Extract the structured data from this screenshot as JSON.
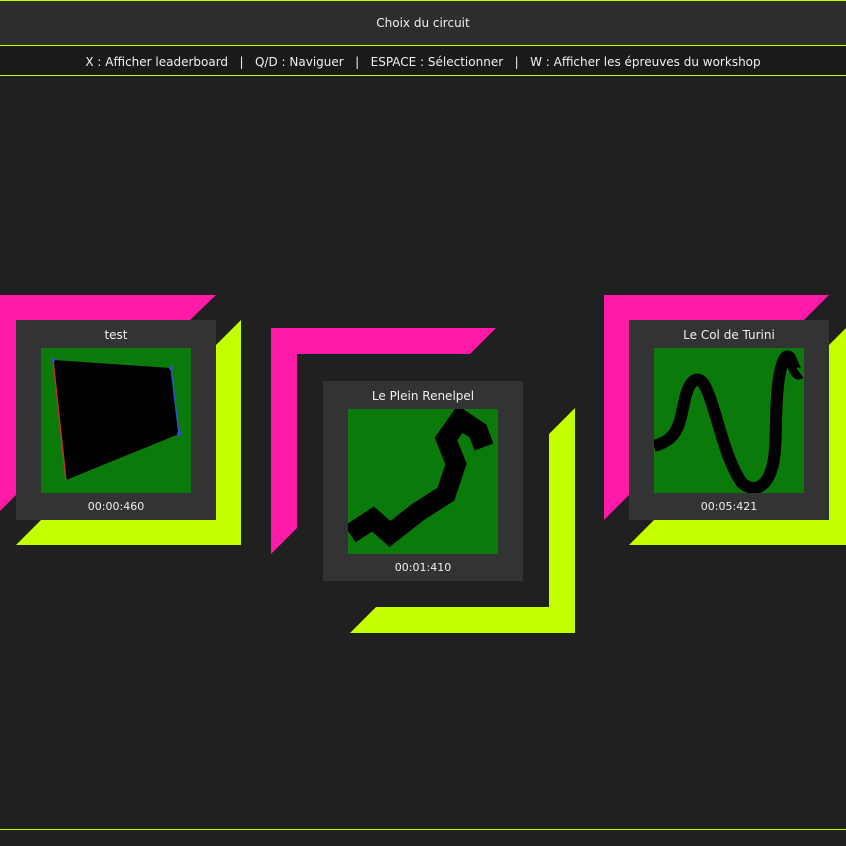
{
  "header": {
    "title": "Choix du circuit",
    "hints": "X : Afficher leaderboard   |   Q/D : Naviguer   |   ESPACE : Sélectionner   |   W : Afficher les épreuves du workshop"
  },
  "colors": {
    "accent_pink": "#ff1aa8",
    "accent_lime": "#c4ff00",
    "background": "#202020",
    "card": "#333333",
    "thumbnail_grass": "#0a7a0a"
  },
  "tracks": [
    {
      "name": "test",
      "best_time": "00:00:460",
      "selected": false
    },
    {
      "name": "Le Plein Renelpel",
      "best_time": "00:01:410",
      "selected": true
    },
    {
      "name": "Le Col de Turini",
      "best_time": "00:05:421",
      "selected": false
    }
  ]
}
